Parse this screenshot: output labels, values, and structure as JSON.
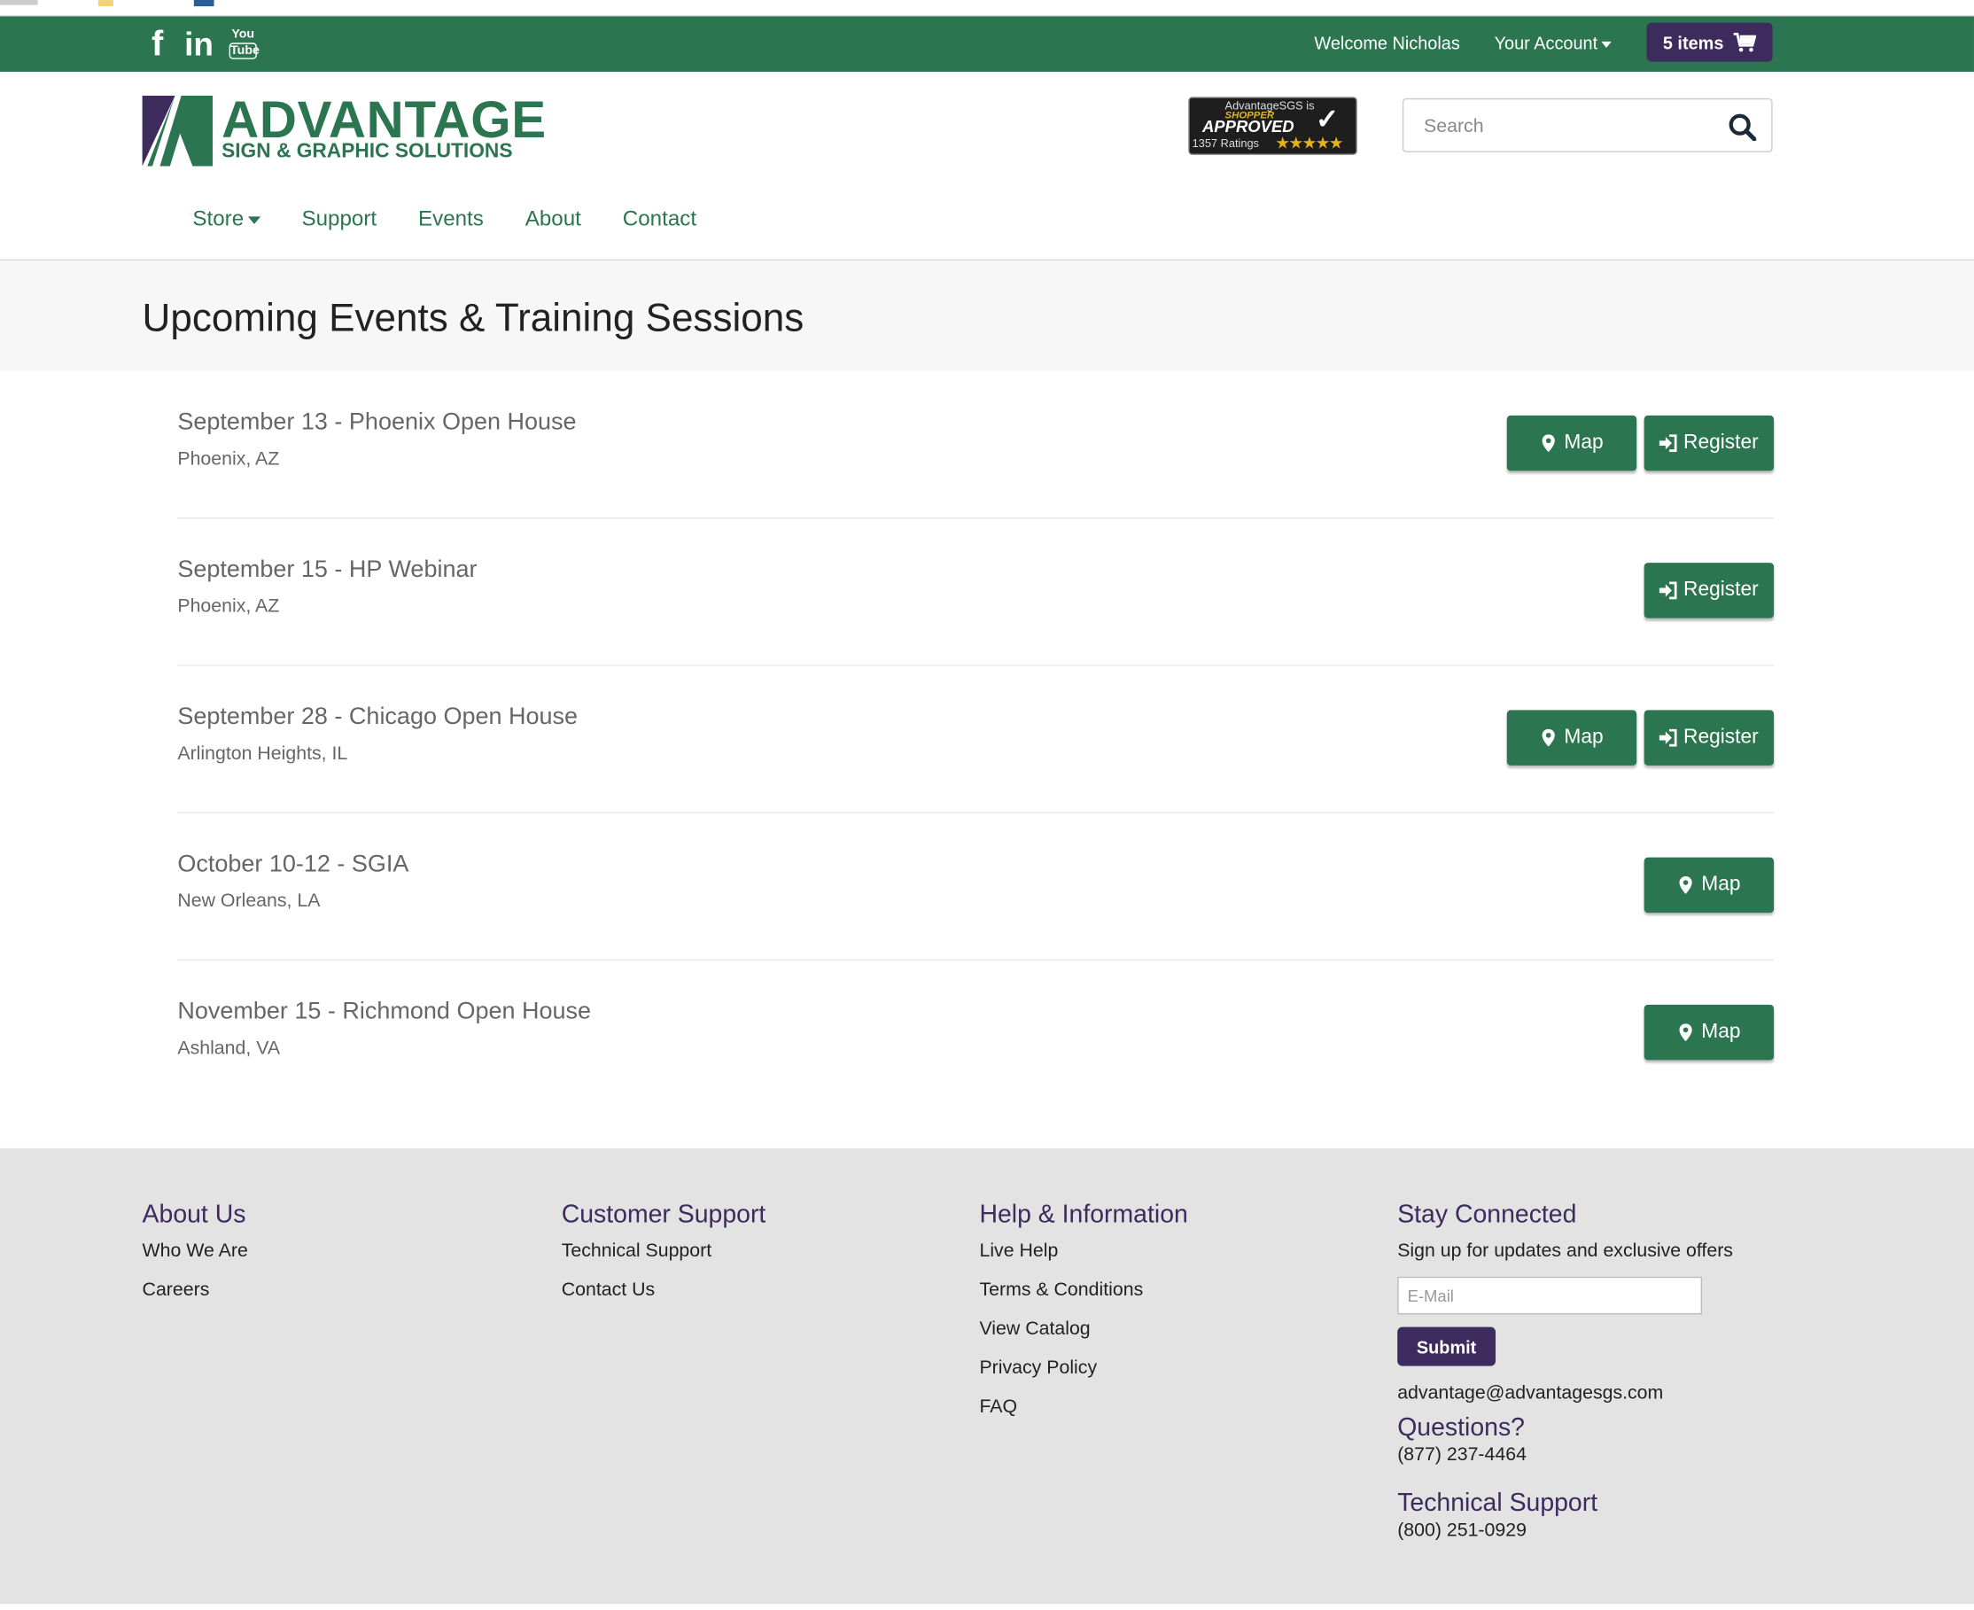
{
  "top_bar": {
    "social": [
      "facebook-icon",
      "linkedin-icon",
      "youtube-icon"
    ],
    "social_glyphs": {
      "facebook": "f",
      "linkedin": "in",
      "youtube_top": "You",
      "youtube_bottom": "Tube"
    },
    "welcome": "Welcome Nicholas",
    "account": "Your Account",
    "cart": "5 items"
  },
  "header": {
    "logo_word": "ADVANTAGE",
    "logo_sub": "SIGN & GRAPHIC SOLUTIONS",
    "badge": {
      "line1": "AdvantageSGS is",
      "line2": "SHOPPER",
      "line3": "APPROVED",
      "ratings": "1357 Ratings",
      "stars": "★★★★★"
    },
    "search_placeholder": "Search"
  },
  "nav": [
    "Store",
    "Support",
    "Events",
    "About",
    "Contact"
  ],
  "page_title": "Upcoming Events & Training Sessions",
  "events": [
    {
      "name": "September 13 - Phoenix Open House",
      "location": "Phoenix, AZ",
      "map": "Map",
      "register": "Register"
    },
    {
      "name": "September 15 - HP Webinar",
      "location": "Phoenix, AZ",
      "map": "",
      "register": "Register"
    },
    {
      "name": "September 28 - Chicago Open House",
      "location": "Arlington Heights, IL",
      "map": "Map",
      "register": "Register"
    },
    {
      "name": "October 10-12 - SGIA",
      "location": "New Orleans, LA",
      "map": "Map",
      "register": ""
    },
    {
      "name": "November 15 - Richmond Open House",
      "location": "Ashland, VA",
      "map": "Map",
      "register": ""
    }
  ],
  "footer": {
    "about": {
      "title": "About Us",
      "links": [
        "Who We Are",
        "Careers"
      ]
    },
    "support": {
      "title": "Customer Support",
      "links": [
        "Technical Support",
        "Contact Us"
      ]
    },
    "help": {
      "title": "Help & Information",
      "links": [
        "Live Help",
        "Terms & Conditions",
        "View Catalog",
        "Privacy Policy",
        "FAQ"
      ]
    },
    "connected": {
      "title": "Stay Connected",
      "signup": "Sign up for updates and exclusive offers",
      "email_placeholder": "E-Mail",
      "submit": "Submit",
      "email": "advantage@advantagesgs.com",
      "questions": "Questions?",
      "questions_phone": "(877) 237-4464",
      "tech_title": "Technical Support",
      "tech_phone": "(800) 251-0929"
    }
  },
  "colors": {
    "brand_green": "#2b7550",
    "brand_purple": "#3d2b5e",
    "footer_bg": "#e3e3e3"
  }
}
